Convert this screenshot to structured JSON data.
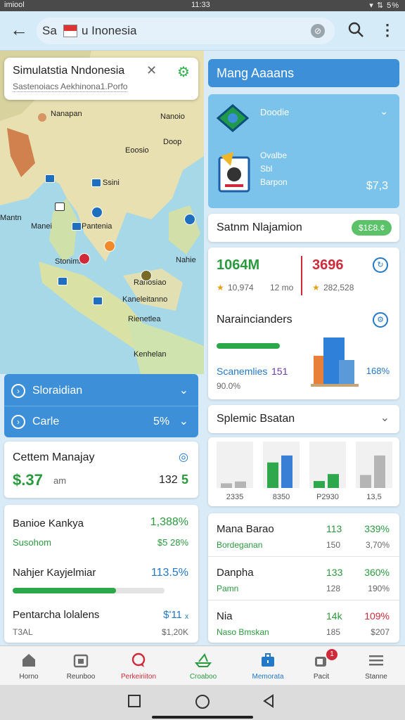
{
  "status": {
    "left": "imiool",
    "time": "11:33",
    "right": "▾ ⇅ 5%"
  },
  "appbar": {
    "search_prefix": "Sa",
    "search_text": "u Inonesia"
  },
  "map_card": {
    "title": "Simulatstia Nndonesia",
    "subtitle": "Sastenoiacs Aekhinona1.Porfo"
  },
  "map_labels": [
    "Nanapan",
    "Nanoio",
    "Doop",
    "Eoosio",
    "Ssini",
    "Mantn",
    "Manei",
    "Pantenia",
    "Stonimn",
    "Nahie",
    "Ranosiao",
    "Kaneleitanno",
    "Rienetlea",
    "Kenhelan"
  ],
  "left_dropdowns": [
    {
      "label": "Sloraidian",
      "value": ""
    },
    {
      "label": "Carle",
      "value": "5%"
    }
  ],
  "cettem": {
    "title": "Cettem Manajay",
    "price": "$.37",
    "price_unit": "am",
    "count": "132",
    "count_suffix": "5"
  },
  "left_list": [
    {
      "title": "Banioe Kankya",
      "value": "1,388%",
      "sub": "Susohom",
      "sub_value": "$5 28%"
    },
    {
      "title": "Nahjer Kayjelmiar",
      "value": "113.5%",
      "progress": 0.68
    },
    {
      "title": "Pentarcha lolalens",
      "value": "$ʹ11 ₓ",
      "sub": "T3AL",
      "sub_value": "$1,20K"
    }
  ],
  "right_header": {
    "title": "Mang Aaaans"
  },
  "right_panel": {
    "top_label": "Doodie",
    "lines": [
      "Ovalbe",
      "Sbl",
      "Barpon"
    ],
    "amount": "$7,3"
  },
  "saturn": {
    "title": "Satnm Nlajamion",
    "badge": "$1Ɛ8.¢"
  },
  "stats": {
    "a": "1064M",
    "b": "3696",
    "a_sub": "10,974",
    "a_unit": "12 mo",
    "b_sub": "282,528"
  },
  "narain": {
    "title": "Naraincianders",
    "progress": 0.85,
    "label": "Scanemlies",
    "label_num": "151",
    "value": "168%",
    "sub": "90.0%"
  },
  "splemic": {
    "title": "Splemic Bsatan"
  },
  "chart_data": {
    "type": "bar",
    "categories": [
      "2335",
      "8350",
      "P2930",
      "13,5"
    ],
    "series": [
      {
        "values": [
          10,
          55,
          15,
          28
        ]
      },
      {
        "values": [
          14,
          70,
          30,
          70
        ]
      }
    ],
    "ylim": [
      0,
      100
    ],
    "colors": [
      "#2ea84a",
      "#3a7fd6",
      "#b5b5b5"
    ]
  },
  "right_list": [
    {
      "title": "Mana Barao",
      "v1": "113",
      "v2": "339%",
      "sub": "Bordeganan",
      "s1": "150",
      "s2": "3,70%"
    },
    {
      "title": "Danpha",
      "v1": "133",
      "v2": "360%",
      "sub": "Pamn",
      "s1": "128",
      "s2": "190%"
    },
    {
      "title": "Nia",
      "v1": "14k",
      "v2": "109%",
      "sub": "Naso Bmskan",
      "s1": "185",
      "s2": "$207"
    }
  ],
  "bottom_nav": [
    {
      "label": "Horno",
      "icon": "home-icon",
      "color": "#6c6c6c"
    },
    {
      "label": "Reunboo",
      "icon": "calendar-icon",
      "color": "#6c6c6c"
    },
    {
      "label": "Perkeiriiton",
      "icon": "chat-icon",
      "color": "#d02a3a"
    },
    {
      "label": "Croaboo",
      "icon": "ship-icon",
      "color": "#2a9a3e"
    },
    {
      "label": "Memorata",
      "icon": "briefcase-icon",
      "color": "#2378c8"
    },
    {
      "label": "Pacit",
      "icon": "wallet-icon",
      "color": "#6c6c6c",
      "badge": "1"
    },
    {
      "label": "Stanne",
      "icon": "menu-icon",
      "color": "#6c6c6c"
    }
  ]
}
